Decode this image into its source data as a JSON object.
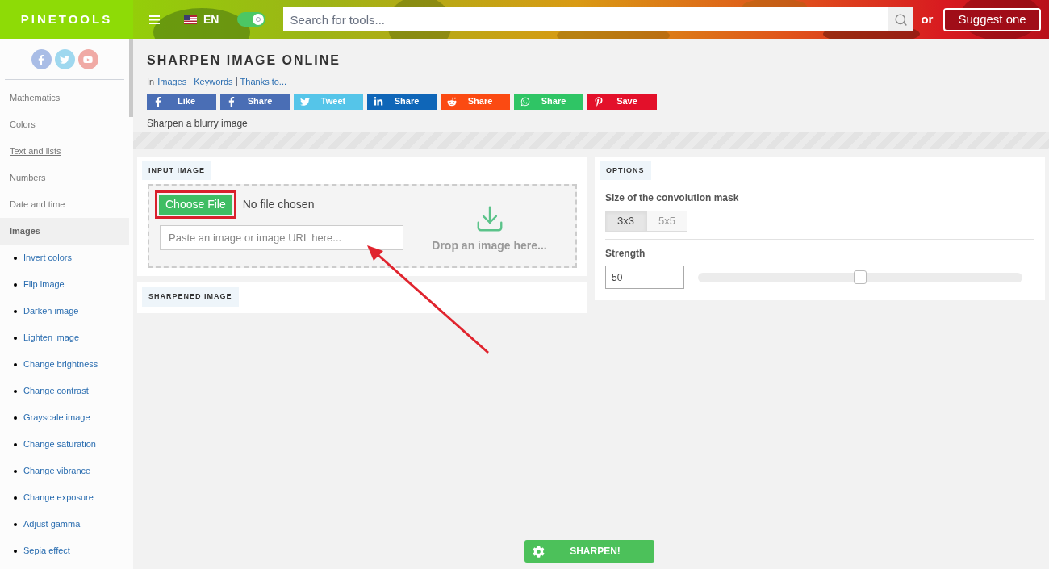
{
  "header": {
    "logo": "PINETOOLS",
    "language": "EN",
    "dark_mode_toggle": {
      "on": true
    },
    "search": {
      "placeholder": "Search for tools..."
    },
    "or_text": "or",
    "suggest_button": "Suggest one"
  },
  "sidebar": {
    "social": [
      {
        "kind": "facebook",
        "color": "#a9bde6"
      },
      {
        "kind": "twitter",
        "color": "#9fd8ef"
      },
      {
        "kind": "youtube",
        "color": "#f0aaa5"
      }
    ],
    "items": [
      {
        "label": "Mathematics",
        "selected": false,
        "underlined": false
      },
      {
        "label": "Colors",
        "selected": false,
        "underlined": false
      },
      {
        "label": "Text and lists",
        "selected": false,
        "underlined": true
      },
      {
        "label": "Numbers",
        "selected": false,
        "underlined": false
      },
      {
        "label": "Date and time",
        "selected": false,
        "underlined": false
      },
      {
        "label": "Images",
        "selected": true,
        "underlined": false,
        "children": [
          {
            "label": "Invert colors"
          },
          {
            "label": "Flip image"
          },
          {
            "label": "Darken image"
          },
          {
            "label": "Lighten image"
          },
          {
            "label": "Change brightness"
          },
          {
            "label": "Change contrast"
          },
          {
            "label": "Grayscale image"
          },
          {
            "label": "Change saturation"
          },
          {
            "label": "Change vibrance"
          },
          {
            "label": "Change exposure"
          },
          {
            "label": "Adjust gamma"
          },
          {
            "label": "Sepia effect"
          }
        ]
      }
    ]
  },
  "page": {
    "title": "SHARPEN IMAGE ONLINE",
    "breadcrumb_prefix": "In",
    "links": [
      "Images",
      "Keywords",
      "Thanks to..."
    ],
    "share_buttons": [
      {
        "kind": "facebook",
        "label": "Like",
        "color": "#4a6eb5"
      },
      {
        "kind": "facebook",
        "label": "Share",
        "color": "#4a6eb5"
      },
      {
        "kind": "twitter",
        "label": "Tweet",
        "color": "#55c5e9"
      },
      {
        "kind": "linkedin",
        "label": "Share",
        "color": "#0f66b8"
      },
      {
        "kind": "reddit",
        "label": "Share",
        "color": "#fb4a12"
      },
      {
        "kind": "whatsapp",
        "label": "Share",
        "color": "#2fc565"
      },
      {
        "kind": "pinterest",
        "label": "Save",
        "color": "#e3102a"
      }
    ],
    "description": "Sharpen a blurry image"
  },
  "input_panel": {
    "title": "INPUT IMAGE",
    "choose_file": "Choose File",
    "file_status": "No file chosen",
    "url_field": {
      "placeholder": "Paste an image or image URL here..."
    },
    "drop_text": "Drop an image here..."
  },
  "output_panel": {
    "title": "SHARPENED IMAGE"
  },
  "options_panel": {
    "title": "OPTIONS",
    "mask_label": "Size of the convolution mask",
    "mask_options": [
      {
        "label": "3x3",
        "selected": true
      },
      {
        "label": "5x5",
        "selected": false
      }
    ],
    "strength_label": "Strength",
    "strength_value": "50",
    "strength": {
      "level": 0.5
    }
  },
  "sharpen_button": "SHARPEN!"
}
